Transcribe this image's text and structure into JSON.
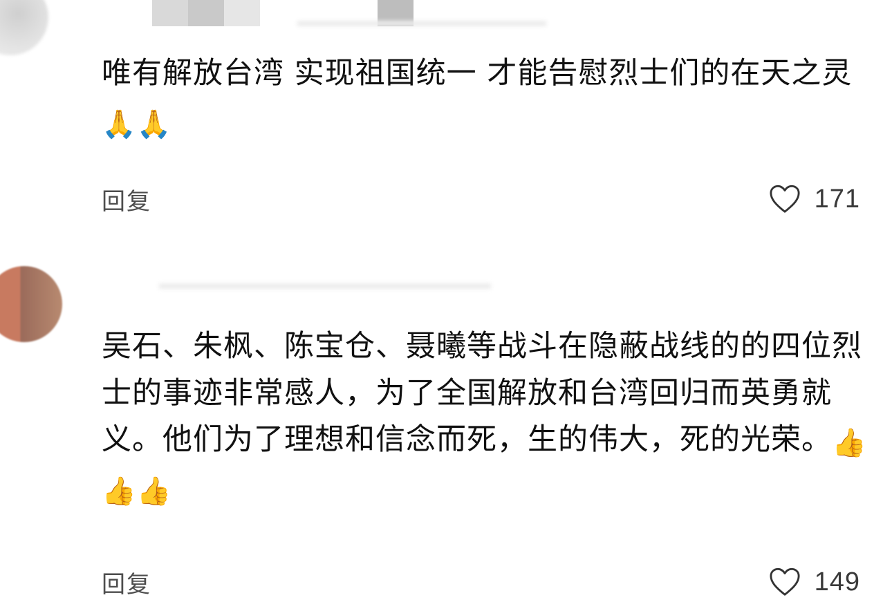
{
  "comments": [
    {
      "text": "唯有解放台湾 实现祖国统一 才能告慰烈士们的在天之灵",
      "emojis": [
        "🙏",
        "🙏"
      ],
      "reply_label": "回复",
      "like_count": "171",
      "colors": {
        "avatar": "#d8d8d8",
        "mosaic": [
          "#d9d9d9",
          "#c9c9c9",
          "#e6e6e6",
          "#ffffff",
          "#bdbdbd"
        ]
      }
    },
    {
      "text": "吴石、朱枫、陈宝仓、聂曦等战斗在隐蔽战线的的四位烈士的事迹非常感人，为了全国解放和台湾回归而英勇就义。他们为了理想和信念而死，生的伟大，死的光荣。",
      "emojis": [
        "👍",
        "👍",
        "👍"
      ],
      "reply_label": "回复",
      "like_count": "149",
      "colors": {
        "avatar": "#c87a60"
      }
    }
  ],
  "theme": {
    "text": "#111111",
    "secondary_text": "#4d4d4d",
    "background": "#ffffff",
    "heart_stroke": "#333333"
  }
}
